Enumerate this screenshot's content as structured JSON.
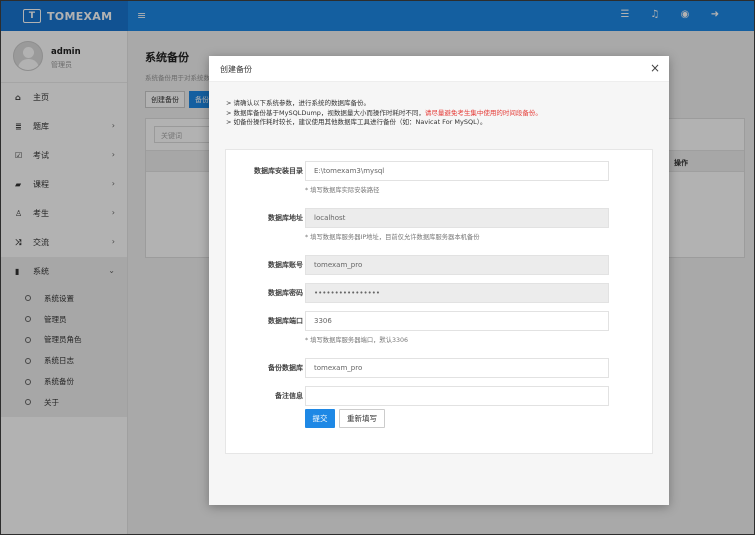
{
  "brand": {
    "logo_text": "T",
    "name": "TOMEXAM"
  },
  "topbar": {
    "menu_icon": "≡",
    "icons": [
      "list-icon",
      "bell-icon",
      "user-circle-icon",
      "logout-icon"
    ]
  },
  "user": {
    "name": "admin",
    "role": "管理员"
  },
  "nav": [
    {
      "label": "主页",
      "icon": "home-icon",
      "glyph": "⌂",
      "chevron": ""
    },
    {
      "label": "题库",
      "icon": "database-icon",
      "glyph": "≣",
      "chevron": "›"
    },
    {
      "label": "考试",
      "icon": "calendar-icon",
      "glyph": "☑",
      "chevron": "›"
    },
    {
      "label": "课程",
      "icon": "book-icon",
      "glyph": "▰",
      "chevron": "›"
    },
    {
      "label": "考生",
      "icon": "person-icon",
      "glyph": "♙",
      "chevron": "›"
    },
    {
      "label": "交流",
      "icon": "shuffle-icon",
      "glyph": "⤨",
      "chevron": "›"
    },
    {
      "label": "系统",
      "icon": "cylinder-icon",
      "glyph": "▮",
      "chevron": "⌄"
    }
  ],
  "subnav": [
    "系统设置",
    "管理员",
    "管理员角色",
    "系统日志",
    "系统备份",
    "关于"
  ],
  "page": {
    "title": "系统备份",
    "subtitle": "系统备份用于对系统数",
    "tab_create": "创建备份",
    "tab_backup": "备份",
    "keyword_placeholder": "关键词",
    "col_action": "操作"
  },
  "modal": {
    "title": "创建备份",
    "close": "×",
    "note1": "> 请确认以下系统参数，进行系统的数据库备份。",
    "note2_a": "> 数据库备份基于MySQLDump，视数据量大小而操作时耗时不同，",
    "note2_red": "请尽量避免考生集中使用的时间段备份。",
    "note3": "> 如备份操作耗时较长，建议使用其他数据库工具进行备份（如：Navicat For MySQL）。",
    "fields": {
      "install_dir": {
        "label": "数据库安装目录",
        "value": "E:\\tomexam3\\mysql",
        "hint": "* 填写数据库实际安装路径"
      },
      "host": {
        "label": "数据库地址",
        "value": "localhost",
        "hint": "* 填写数据库服务器IP地址，目前仅允许数据库服务器本机备份"
      },
      "user": {
        "label": "数据库账号",
        "value": "tomexam_pro"
      },
      "password": {
        "label": "数据库密码",
        "value": "••••••••••••••••"
      },
      "port": {
        "label": "数据库端口",
        "value": "3306",
        "hint": "* 填写数据库服务器端口，默认3306"
      },
      "backup_db": {
        "label": "备份数据库",
        "value": "tomexam_pro"
      },
      "remark": {
        "label": "备注信息",
        "value": ""
      }
    },
    "submit": "提交",
    "reset": "重新填写"
  }
}
